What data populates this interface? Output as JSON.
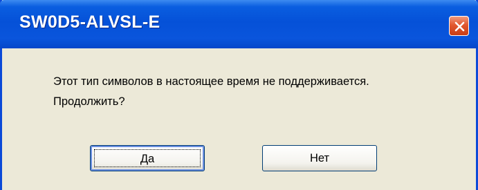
{
  "dialog": {
    "title": "SW0D5-ALVSL-E",
    "message_line1": "Этот тип символов в настоящее время не поддерживается.",
    "message_line2": "Продолжить?",
    "yes_label": "Да",
    "no_label": "Нет",
    "close_icon": "close-icon"
  },
  "colors": {
    "titlebar": "#0551d8",
    "close_button": "#e2582f",
    "dialog_background": "#ece9d8",
    "button_border": "#003c74"
  }
}
